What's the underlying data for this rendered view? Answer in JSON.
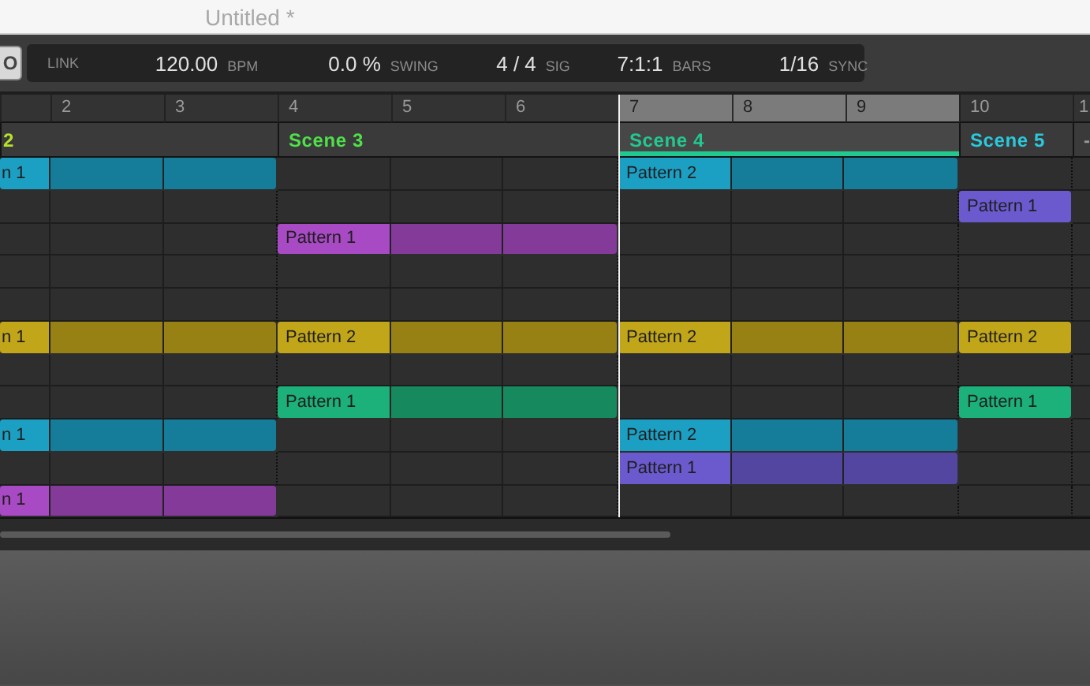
{
  "window": {
    "title": "Untitled *"
  },
  "toolbar": {
    "left_button": "O",
    "link": "LINK",
    "tempo": {
      "value": "120.00",
      "unit": "BPM"
    },
    "swing": {
      "value": "0.0 %",
      "unit": "SWING"
    },
    "signature": {
      "value": "4 / 4",
      "unit": "SIG"
    },
    "position": {
      "value": "7:1:1",
      "unit": "BARS"
    },
    "quantize": {
      "value": "1/16",
      "unit": "SYNC"
    }
  },
  "scenes": [
    {
      "label": "2",
      "bars": [
        "2",
        "3"
      ],
      "color": "#b7e22a",
      "selected": false,
      "tracks": [
        {
          "kind": "pattern",
          "label": "n 1",
          "color": "#1ba0c4"
        },
        {
          "kind": "empty"
        },
        {
          "kind": "empty"
        },
        {
          "kind": "empty"
        },
        {
          "kind": "empty"
        },
        {
          "kind": "pattern",
          "label": "n 1",
          "color": "#c2a619"
        },
        {
          "kind": "empty"
        },
        {
          "kind": "empty"
        },
        {
          "kind": "pattern",
          "label": "n 1",
          "color": "#1ba0c4"
        },
        {
          "kind": "empty"
        },
        {
          "kind": "pattern",
          "label": "n 1",
          "color": "#a84ac4"
        }
      ]
    },
    {
      "label": "Scene 3",
      "bars": [
        "4",
        "5",
        "6"
      ],
      "color": "#4fe04a",
      "selected": false,
      "tracks": [
        {
          "kind": "empty"
        },
        {
          "kind": "empty"
        },
        {
          "kind": "pattern",
          "label": "Pattern 1",
          "color": "#a84ac4"
        },
        {
          "kind": "empty"
        },
        {
          "kind": "empty"
        },
        {
          "kind": "pattern",
          "label": "Pattern 2",
          "color": "#c2a619"
        },
        {
          "kind": "empty"
        },
        {
          "kind": "pattern",
          "label": "Pattern 1",
          "color": "#1cb07a"
        },
        {
          "kind": "empty"
        },
        {
          "kind": "empty"
        },
        {
          "kind": "empty"
        }
      ]
    },
    {
      "label": "Scene 4",
      "bars": [
        "7",
        "8",
        "9"
      ],
      "color": "#22c98e",
      "selected": true,
      "tracks": [
        {
          "kind": "pattern",
          "label": "Pattern 2",
          "color": "#1ba0c4"
        },
        {
          "kind": "empty"
        },
        {
          "kind": "empty"
        },
        {
          "kind": "empty"
        },
        {
          "kind": "empty"
        },
        {
          "kind": "pattern",
          "label": "Pattern 2",
          "color": "#c2a619"
        },
        {
          "kind": "empty"
        },
        {
          "kind": "empty"
        },
        {
          "kind": "pattern",
          "label": "Pattern 2",
          "color": "#1ba0c4"
        },
        {
          "kind": "pattern",
          "label": "Pattern 1",
          "color": "#6a5acd"
        },
        {
          "kind": "empty"
        }
      ]
    },
    {
      "label": "Scene 5",
      "bars": [
        "10"
      ],
      "color": "#2cc8dc",
      "selected": false,
      "tracks": [
        {
          "kind": "empty"
        },
        {
          "kind": "pattern",
          "label": "Pattern 1",
          "color": "#6a5acd"
        },
        {
          "kind": "empty"
        },
        {
          "kind": "empty"
        },
        {
          "kind": "empty"
        },
        {
          "kind": "pattern",
          "label": "Pattern 2",
          "color": "#c2a619"
        },
        {
          "kind": "empty"
        },
        {
          "kind": "pattern",
          "label": "Pattern 1",
          "color": "#1cb07a"
        },
        {
          "kind": "empty"
        },
        {
          "kind": "empty"
        },
        {
          "kind": "empty"
        }
      ]
    },
    {
      "label": "-",
      "bars": [
        "1"
      ],
      "color": "#999999",
      "selected": false,
      "tracks": [
        {
          "kind": "empty"
        },
        {
          "kind": "empty"
        },
        {
          "kind": "empty"
        },
        {
          "kind": "empty"
        },
        {
          "kind": "empty"
        },
        {
          "kind": "empty"
        },
        {
          "kind": "empty"
        },
        {
          "kind": "empty"
        },
        {
          "kind": "empty"
        },
        {
          "kind": "empty"
        },
        {
          "kind": "empty"
        }
      ]
    }
  ]
}
